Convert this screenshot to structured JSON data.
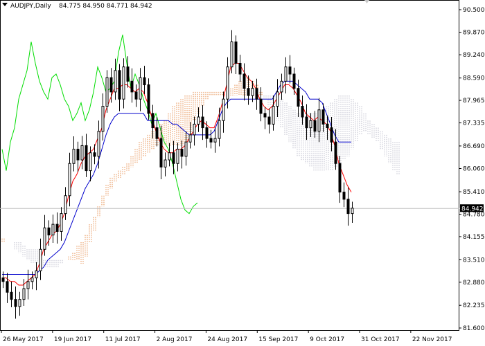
{
  "header": {
    "symbol_label": "AUDJPY,Daily",
    "ohlc_label": "84.775 84.950 84.771 84.942"
  },
  "colors": {
    "background": "#ffffff",
    "candle": "#000000",
    "tenkan": "#ff0000",
    "kijun": "#0000cc",
    "chikou": "#00dd00",
    "cloud_up": "#e07020",
    "cloud_down": "#b0b0c0",
    "price_badge": "#000000",
    "price_line": "#c0c0c0"
  },
  "chart_data": {
    "type": "candlestick",
    "title": "AUDJPY,Daily",
    "indicator": "Ichimoku Kinko Hyo",
    "ylim": [
      81.6,
      90.5
    ],
    "y_ticks": [
      "90.500",
      "89.870",
      "89.240",
      "88.590",
      "87.965",
      "87.335",
      "86.690",
      "86.060",
      "85.410",
      "84.780",
      "84.155",
      "83.510",
      "82.880",
      "82.235",
      "81.600"
    ],
    "x_ticks": [
      "26 May 2017",
      "19 Jun 2017",
      "11 Jul 2017",
      "2 Aug 2017",
      "24 Aug 2017",
      "15 Sep 2017",
      "9 Oct 2017",
      "31 Oct 2017",
      "22 Nov 2017"
    ],
    "current_price": "84.942",
    "last_bar": {
      "open": 84.775,
      "high": 84.95,
      "low": 84.771,
      "close": 84.942
    },
    "series": [
      {
        "key": "close",
        "values": [
          82.9,
          82.6,
          82.4,
          82.2,
          82.4,
          82.7,
          82.9,
          83.0,
          83.2,
          83.8,
          84.4,
          84.2,
          84.5,
          84.3,
          84.8,
          85.3,
          86.2,
          86.6,
          86.3,
          86.7,
          86.0,
          86.5,
          86.4,
          87.1,
          87.8,
          88.6,
          88.2,
          88.8,
          88.0,
          88.9,
          88.5,
          88.2,
          88.0,
          88.6,
          88.4,
          87.6,
          87.2,
          86.9,
          86.1,
          86.3,
          86.5,
          86.2,
          86.6,
          86.4,
          86.8,
          87.0,
          87.3,
          87.5,
          87.2,
          86.9,
          86.8,
          86.9,
          87.4,
          88.0,
          88.9,
          89.6,
          89.0,
          88.7,
          88.3,
          88.1,
          88.3,
          88.0,
          87.6,
          87.5,
          87.3,
          87.8,
          88.2,
          88.5,
          88.9,
          88.7,
          88.3,
          87.8,
          87.5,
          87.2,
          87.4,
          87.1,
          87.7,
          87.3,
          87.2,
          86.8,
          86.2,
          85.4,
          85.2,
          84.8,
          84.95
        ]
      },
      {
        "key": "tenkan",
        "color": "#ff0000",
        "values": [
          83.0,
          83.0,
          82.9,
          82.9,
          82.8,
          82.8,
          82.9,
          83.0,
          83.1,
          83.4,
          83.8,
          84.0,
          84.2,
          84.3,
          84.5,
          84.8,
          85.3,
          85.7,
          85.9,
          86.2,
          86.4,
          86.5,
          86.6,
          86.9,
          87.2,
          87.7,
          88.0,
          88.3,
          88.3,
          88.4,
          88.4,
          88.3,
          88.2,
          88.3,
          88.2,
          87.9,
          87.5,
          87.1,
          86.8,
          86.6,
          86.5,
          86.5,
          86.6,
          86.6,
          86.7,
          86.9,
          87.1,
          87.3,
          87.4,
          87.3,
          87.2,
          87.2,
          87.5,
          87.9,
          88.4,
          88.9,
          89.0,
          89.0,
          88.8,
          88.6,
          88.5,
          88.3,
          88.0,
          87.8,
          87.7,
          87.8,
          88.0,
          88.2,
          88.4,
          88.4,
          88.3,
          88.1,
          87.9,
          87.6,
          87.5,
          87.4,
          87.5,
          87.4,
          87.3,
          87.1,
          86.7,
          86.2,
          85.9,
          85.6,
          85.4
        ]
      },
      {
        "key": "kijun",
        "color": "#0000cc",
        "values": [
          83.1,
          83.1,
          83.1,
          83.1,
          83.1,
          83.1,
          83.1,
          83.1,
          83.1,
          83.2,
          83.3,
          83.5,
          83.6,
          83.7,
          83.8,
          84.0,
          84.3,
          84.6,
          84.9,
          85.2,
          85.5,
          85.7,
          85.9,
          86.2,
          86.6,
          87.0,
          87.3,
          87.5,
          87.6,
          87.6,
          87.6,
          87.6,
          87.6,
          87.6,
          87.6,
          87.4,
          87.4,
          87.4,
          87.4,
          87.4,
          87.4,
          87.3,
          87.3,
          87.2,
          87.1,
          87.0,
          87.0,
          87.0,
          87.0,
          87.0,
          87.0,
          87.1,
          87.4,
          87.7,
          87.9,
          88.0,
          88.0,
          88.0,
          88.0,
          88.0,
          88.0,
          88.0,
          88.0,
          88.0,
          88.0,
          88.0,
          88.2,
          88.4,
          88.5,
          88.5,
          88.5,
          88.4,
          88.3,
          88.2,
          88.0,
          88.0,
          88.0,
          87.9,
          87.6,
          87.3,
          87.0,
          86.8,
          86.8,
          86.8,
          86.8
        ]
      },
      {
        "key": "chikou",
        "color": "#00dd00",
        "values": [
          86.6,
          86.0,
          86.8,
          87.2,
          88.0,
          88.4,
          88.8,
          89.6,
          89.0,
          88.5,
          88.2,
          88.0,
          88.6,
          88.7,
          88.4,
          88.0,
          87.8,
          87.4,
          87.6,
          87.9,
          87.4,
          87.7,
          88.2,
          88.9,
          88.6,
          88.2,
          88.3,
          88.5,
          89.3,
          89.8,
          89.0,
          88.3,
          88.7,
          88.4,
          88.0,
          87.7,
          87.3,
          87.6,
          87.2,
          86.8,
          86.6,
          86.2,
          85.7,
          85.2,
          84.9,
          84.8,
          85.0,
          85.1
        ]
      },
      {
        "key": "senkou_a",
        "values": [
          84.1,
          84.0,
          84.0,
          83.8,
          83.7,
          83.6,
          83.5,
          83.4,
          83.4,
          83.3,
          83.3,
          83.3,
          83.3,
          83.3,
          83.4,
          83.5,
          83.6,
          83.7,
          83.9,
          84.0,
          84.2,
          84.5,
          84.7,
          85.0,
          85.3,
          85.6,
          85.8,
          85.9,
          86.0,
          86.1,
          86.2,
          86.4,
          86.6,
          86.8,
          86.9,
          87.0,
          87.1,
          87.2,
          87.3,
          87.4,
          87.6,
          87.8,
          87.9,
          88.0,
          88.1,
          88.1,
          88.2,
          88.2,
          88.2,
          88.2,
          88.2,
          88.2,
          88.2,
          88.2,
          88.3,
          88.3,
          88.4,
          88.5,
          88.6,
          88.6,
          88.5,
          88.4,
          88.2,
          88.0,
          87.8,
          87.6,
          87.4,
          87.2,
          87.0,
          86.8,
          86.6,
          86.4,
          86.3,
          86.2,
          86.1,
          86.0,
          86.0,
          86.0,
          86.0,
          86.0,
          86.1,
          86.2,
          86.3,
          86.4,
          86.6,
          86.8,
          87.0,
          87.1,
          87.0,
          86.9,
          86.8,
          86.6,
          86.4,
          86.2,
          86.0,
          85.9
        ]
      },
      {
        "key": "senkou_b",
        "values": [
          84.0,
          84.0,
          84.0,
          84.0,
          84.0,
          83.9,
          83.8,
          83.8,
          83.8,
          83.8,
          83.5,
          83.5,
          83.5,
          83.5,
          83.5,
          83.5,
          83.5,
          83.5,
          83.5,
          83.4,
          83.6,
          84.0,
          84.3,
          84.7,
          85.0,
          85.3,
          85.5,
          85.7,
          85.8,
          85.9,
          86.0,
          86.1,
          86.2,
          86.3,
          86.4,
          86.5,
          86.6,
          86.7,
          86.7,
          86.7,
          86.7,
          86.7,
          86.7,
          86.7,
          86.8,
          87.0,
          87.4,
          87.6,
          87.8,
          88.0,
          88.1,
          88.1,
          88.1,
          88.1,
          88.1,
          88.1,
          88.1,
          88.1,
          88.1,
          88.1,
          88.1,
          88.1,
          88.1,
          88.1,
          88.1,
          88.1,
          88.0,
          88.0,
          87.9,
          87.8,
          87.7,
          87.6,
          87.6,
          87.6,
          87.6,
          87.6,
          87.6,
          87.6,
          87.8,
          87.9,
          88.0,
          88.1,
          88.1,
          88.1,
          88.0,
          87.9,
          87.8,
          87.6,
          87.4,
          87.3,
          87.2,
          87.1,
          87.0,
          86.9,
          86.8,
          86.8
        ]
      }
    ]
  }
}
